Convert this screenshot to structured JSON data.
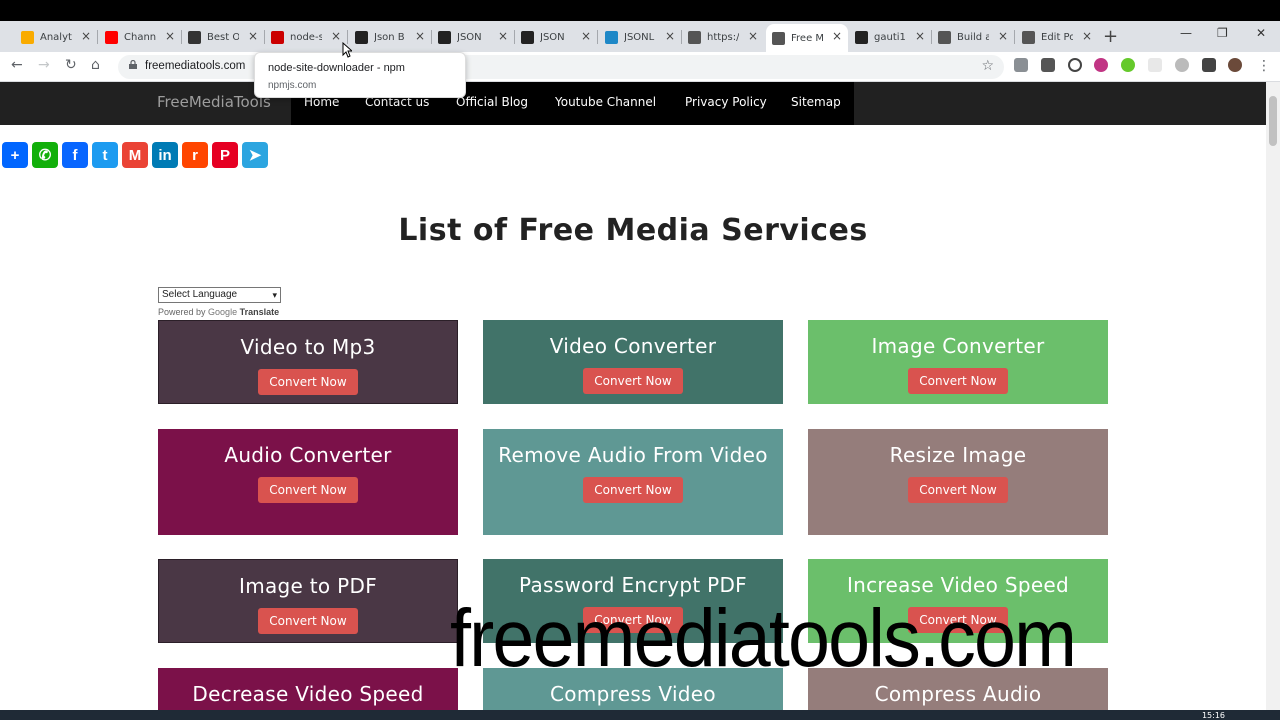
{
  "tabs": [
    {
      "label": "Analyti",
      "favicon": "analytics-icon",
      "color": "#f9ab00"
    },
    {
      "label": "Channe",
      "favicon": "youtube-icon",
      "color": "#ff0000"
    },
    {
      "label": "Best Ol",
      "favicon": "cb-icon",
      "color": "#333333"
    },
    {
      "label": "node-s",
      "favicon": "npm-icon",
      "color": "#cb0000"
    },
    {
      "label": "Json B",
      "favicon": "json-icon",
      "color": "#222222"
    },
    {
      "label": "JSON ",
      "favicon": "json-icon",
      "color": "#222222"
    },
    {
      "label": "JSON ",
      "favicon": "json-icon",
      "color": "#222222"
    },
    {
      "label": "JSONL",
      "favicon": "jsonl-icon",
      "color": "#1e88c7"
    },
    {
      "label": "https:/",
      "favicon": "page-icon",
      "color": "#555555"
    },
    {
      "label": "Free M",
      "favicon": "globe-icon",
      "color": "#555555"
    },
    {
      "label": "gauti1",
      "favicon": "github-icon",
      "color": "#222222"
    },
    {
      "label": "Build a",
      "favicon": "globe-icon",
      "color": "#555555"
    },
    {
      "label": "Edit Po",
      "favicon": "globe-icon",
      "color": "#555555"
    }
  ],
  "address": {
    "url": "freemediatools.com"
  },
  "tooltip": {
    "title": "node-site-downloader - npm",
    "domain": "npmjs.com"
  },
  "site_nav": {
    "brand": "FreeMediaTools",
    "links": [
      "Home",
      "Contact us",
      "Official Blog",
      "Youtube Channel",
      "Privacy Policy",
      "Sitemap"
    ]
  },
  "share": [
    {
      "icon": "add-share-icon",
      "glyph": "+",
      "color": "#0166ff"
    },
    {
      "icon": "whatsapp-icon",
      "glyph": "✆",
      "color": "#12af0a"
    },
    {
      "icon": "facebook-icon",
      "glyph": "f",
      "color": "#0866ff"
    },
    {
      "icon": "twitter-icon",
      "glyph": "t",
      "color": "#1d9bf0"
    },
    {
      "icon": "gmail-icon",
      "glyph": "M",
      "color": "#ea4335"
    },
    {
      "icon": "linkedin-icon",
      "glyph": "in",
      "color": "#007bb5"
    },
    {
      "icon": "reddit-icon",
      "glyph": "r",
      "color": "#ff4500"
    },
    {
      "icon": "pinterest-icon",
      "glyph": "P",
      "color": "#e60023"
    },
    {
      "icon": "telegram-icon",
      "glyph": "➤",
      "color": "#2ca5e0"
    }
  ],
  "heading": "List of Free Media Services",
  "language": {
    "select": "Select Language",
    "powered_by": "Powered by",
    "google": "Google",
    "translate": "Translate"
  },
  "cta_label": "Convert Now",
  "services": [
    {
      "title": "Video to Mp3",
      "color": "#4a3745"
    },
    {
      "title": "Video Converter",
      "color": "#417369"
    },
    {
      "title": "Image Converter",
      "color": "#6bbf6b"
    },
    {
      "title": "Audio Converter",
      "color": "#7b1149"
    },
    {
      "title": "Remove Audio From Video",
      "color": "#5f9894"
    },
    {
      "title": "Resize Image",
      "color": "#957d7b"
    },
    {
      "title": "Image to PDF",
      "color": "#4a3745"
    },
    {
      "title": "Password Encrypt PDF",
      "color": "#417369"
    },
    {
      "title": "Increase Video Speed",
      "color": "#6bbf6b"
    },
    {
      "title": "Decrease Video Speed",
      "color": "#7b1149"
    },
    {
      "title": "Compress Video",
      "color": "#5f9894"
    },
    {
      "title": "Compress Audio",
      "color": "#957d7b"
    }
  ],
  "watermark": "freemediatools.com",
  "taskbar": {
    "clock": "15:16"
  }
}
